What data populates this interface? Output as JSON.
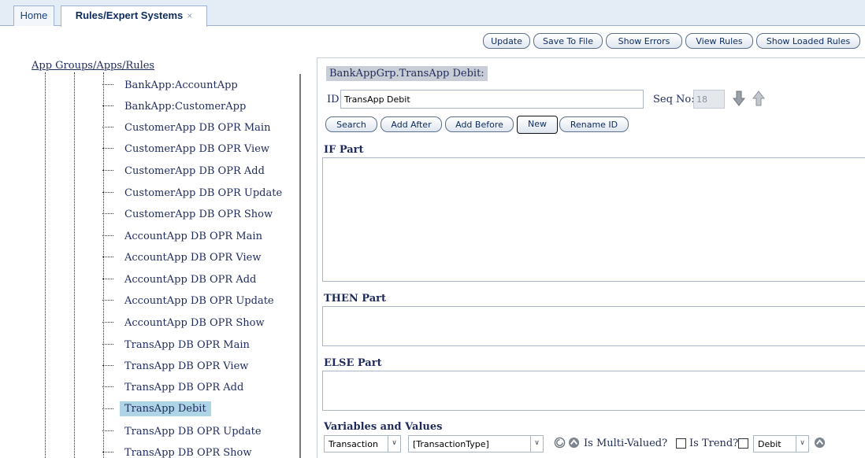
{
  "tabs": [
    {
      "label": "Home"
    },
    {
      "label": "Rules/Expert Systems",
      "close": "×"
    }
  ],
  "toolbar": {
    "update": "Update",
    "save_to_file": "Save To File",
    "show_errors": "Show Errors",
    "view_rules": "View Rules",
    "show_loaded_rules": "Show Loaded Rules"
  },
  "tree": {
    "root_label": "App Groups/Apps/Rules",
    "items": [
      {
        "label": "BankApp:AccountApp"
      },
      {
        "label": "BankApp:CustomerApp"
      },
      {
        "label": "CustomerApp DB OPR Main"
      },
      {
        "label": "CustomerApp DB OPR View"
      },
      {
        "label": "CustomerApp DB OPR Add"
      },
      {
        "label": "CustomerApp DB OPR Update"
      },
      {
        "label": "CustomerApp DB OPR Show"
      },
      {
        "label": "AccountApp DB OPR Main"
      },
      {
        "label": "AccountApp DB OPR View"
      },
      {
        "label": "AccountApp DB OPR Add"
      },
      {
        "label": "AccountApp DB OPR Update"
      },
      {
        "label": "AccountApp DB OPR Show"
      },
      {
        "label": "TransApp DB OPR Main"
      },
      {
        "label": "TransApp DB OPR View"
      },
      {
        "label": "TransApp DB OPR Add"
      },
      {
        "label": "TransApp Debit",
        "selected": true
      },
      {
        "label": "TransApp DB OPR Update"
      },
      {
        "label": "TransApp DB OPR Show"
      }
    ]
  },
  "rule": {
    "title": "BankAppGrp.TransApp Debit:",
    "id_label": "ID",
    "id_value": "TransApp Debit",
    "seq_label": "Seq No:",
    "seq_value": "18"
  },
  "actions": {
    "search": "Search",
    "add_after": "Add After",
    "add_before": "Add Before",
    "new": "New",
    "rename_id": "Rename ID"
  },
  "sections": {
    "if_part": "IF Part",
    "then_part": "THEN Part",
    "else_part": "ELSE Part",
    "variables": "Variables and Values"
  },
  "variables": {
    "object_select": "Transaction",
    "property_select": "[TransactionType]",
    "multi_valued_label": "Is Multi-Valued?",
    "trend_label": "Is Trend?",
    "value_select": "Debit"
  },
  "colors": {
    "tab_bar": "#e4ecf6",
    "selected_item": "#add5e6",
    "title_bg": "#c9cdd6",
    "text": "#1f2a5c"
  }
}
